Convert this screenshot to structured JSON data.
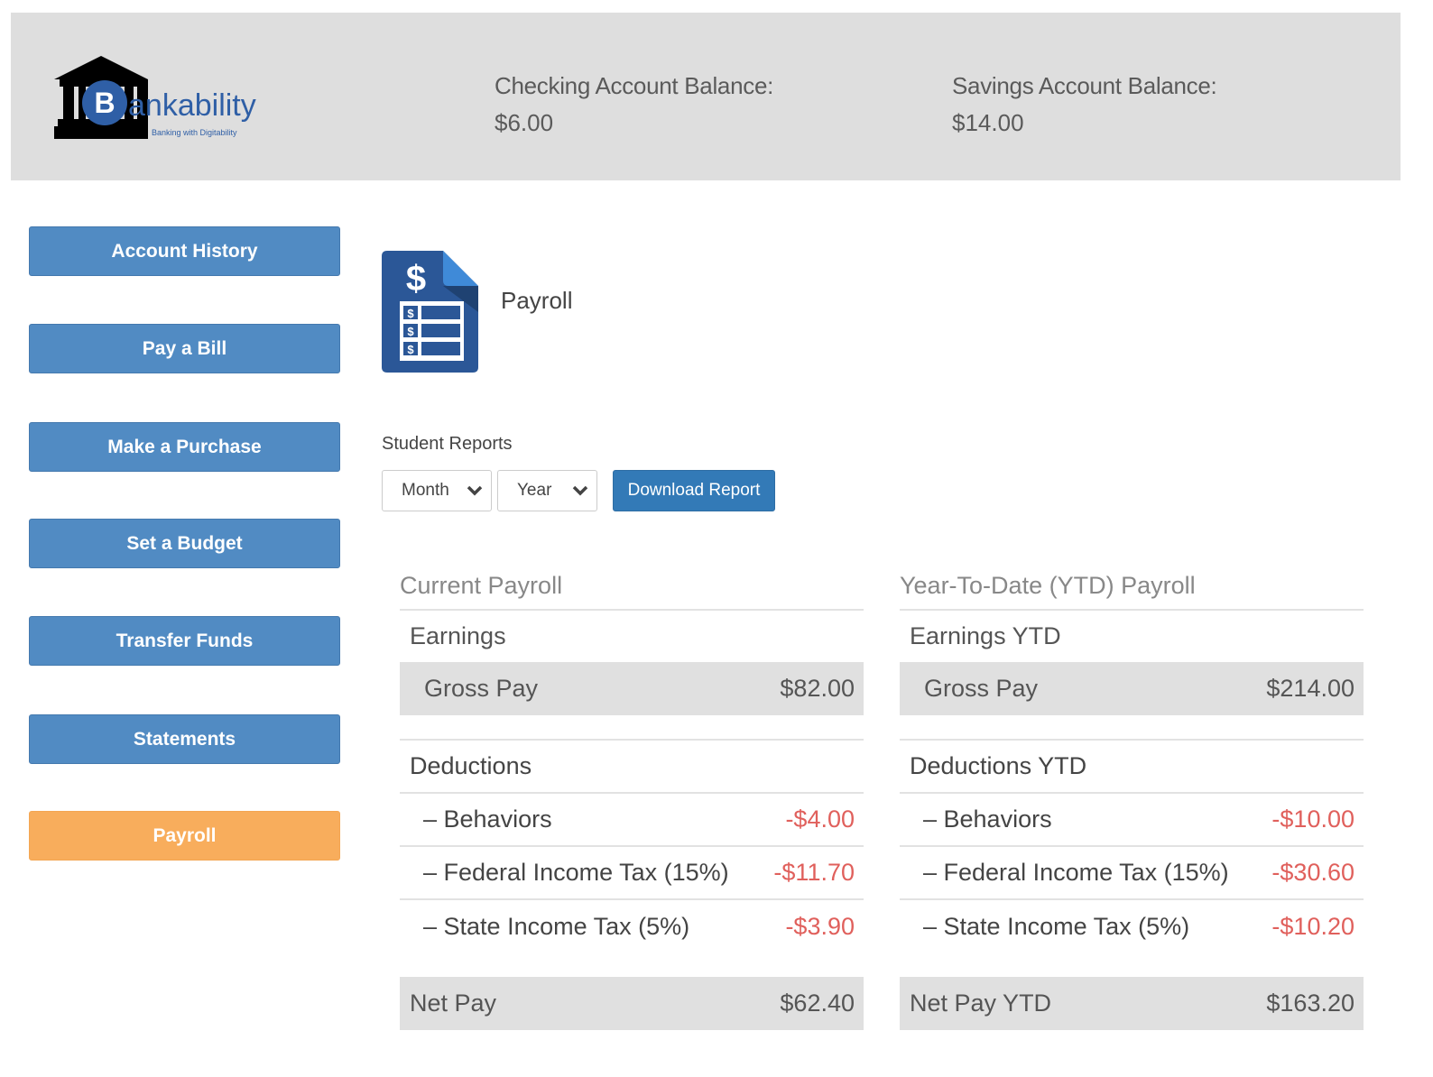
{
  "brand": {
    "name": "Bankability",
    "tagline": "Banking with Digitability",
    "logo_icon": "bank-building-icon",
    "coin_letter": "B"
  },
  "header": {
    "checking_label": "Checking Account Balance:",
    "checking_value": "$6.00",
    "savings_label": "Savings Account Balance:",
    "savings_value": "$14.00"
  },
  "sidebar": {
    "items": [
      {
        "label": "Account History",
        "active": false
      },
      {
        "label": "Pay a Bill",
        "active": false
      },
      {
        "label": "Make a Purchase",
        "active": false
      },
      {
        "label": "Set a Budget",
        "active": false
      },
      {
        "label": "Transfer Funds",
        "active": false
      },
      {
        "label": "Statements",
        "active": false
      },
      {
        "label": "Payroll",
        "active": true
      }
    ]
  },
  "page": {
    "title": "Payroll",
    "icon": "payroll-document-icon"
  },
  "reports": {
    "label": "Student Reports",
    "month_select": "Month",
    "year_select": "Year",
    "download_label": "Download Report"
  },
  "current": {
    "title": "Current Payroll",
    "earnings_label": "Earnings",
    "gross_label": "Gross Pay",
    "gross_value": "$82.00",
    "deductions_label": "Deductions",
    "deductions": [
      {
        "label": "– Behaviors",
        "value": "-$4.00"
      },
      {
        "label": "– Federal Income Tax (15%)",
        "value": "-$11.70"
      },
      {
        "label": "– State Income Tax (5%)",
        "value": "-$3.90"
      }
    ],
    "net_label": "Net Pay",
    "net_value": "$62.40"
  },
  "ytd": {
    "title": "Year-To-Date (YTD) Payroll",
    "earnings_label": "Earnings YTD",
    "gross_label": "Gross Pay",
    "gross_value": "$214.00",
    "deductions_label": "Deductions YTD",
    "deductions": [
      {
        "label": "– Behaviors",
        "value": "-$10.00"
      },
      {
        "label": "– Federal Income Tax (15%)",
        "value": "-$30.60"
      },
      {
        "label": "– State Income Tax (5%)",
        "value": "-$10.20"
      }
    ],
    "net_label": "Net Pay YTD",
    "net_value": "$163.20"
  },
  "colors": {
    "nav_button": "#518bc3",
    "nav_active": "#f8ad5c",
    "primary": "#337ab7",
    "negative": "#e0605c",
    "header_bg": "#dedede"
  }
}
